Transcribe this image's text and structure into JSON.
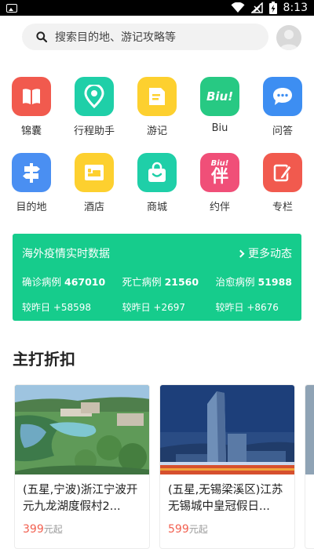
{
  "status": {
    "time": "8:13",
    "icons": [
      "gallery-icon",
      "wifi-icon",
      "signal-icon",
      "battery-icon"
    ]
  },
  "search": {
    "placeholder": "搜索目的地、游记攻略等"
  },
  "grid": {
    "items": [
      {
        "label": "锦囊",
        "icon": "book-icon",
        "color": "#f15a4e"
      },
      {
        "label": "行程助手",
        "icon": "location-pin-icon",
        "color": "#1fcfa8"
      },
      {
        "label": "游记",
        "icon": "notes-icon",
        "color": "#fdd02f"
      },
      {
        "label": "Biu",
        "icon": "biu-icon",
        "color": "#27c983",
        "glyph": "Biu!"
      },
      {
        "label": "问答",
        "icon": "chat-bubble-icon",
        "color": "#3d8ef2"
      },
      {
        "label": "目的地",
        "icon": "signpost-icon",
        "color": "#4a8ff2"
      },
      {
        "label": "酒店",
        "icon": "hotel-bed-icon",
        "color": "#fdd02f"
      },
      {
        "label": "商城",
        "icon": "shopping-bag-icon",
        "color": "#1fcfa8"
      },
      {
        "label": "约伴",
        "icon": "companion-icon",
        "color": "#f04f78",
        "glyph": "伴",
        "sub": "Biu!"
      },
      {
        "label": "专栏",
        "icon": "pen-icon",
        "color": "#f15a4e"
      }
    ]
  },
  "covid": {
    "title": "海外疫情实时数据",
    "more": "更多动态",
    "stats": [
      {
        "label": "确诊病例",
        "value": "467010",
        "delta": "较昨日 +58598"
      },
      {
        "label": "死亡病例",
        "value": "21560",
        "delta": "较昨日 +2697"
      },
      {
        "label": "治愈病例",
        "value": "51988",
        "delta": "较昨日 +8676"
      }
    ]
  },
  "section": {
    "title": "主打折扣"
  },
  "deals": [
    {
      "title": "(五星,宁波)浙江宁波开元九龙湖度假村2...",
      "price": "399",
      "unit": "元起"
    },
    {
      "title": "(五星,无锡梁溪区)江苏无锡城中皇冠假日...",
      "price": "599",
      "unit": "元起"
    }
  ]
}
